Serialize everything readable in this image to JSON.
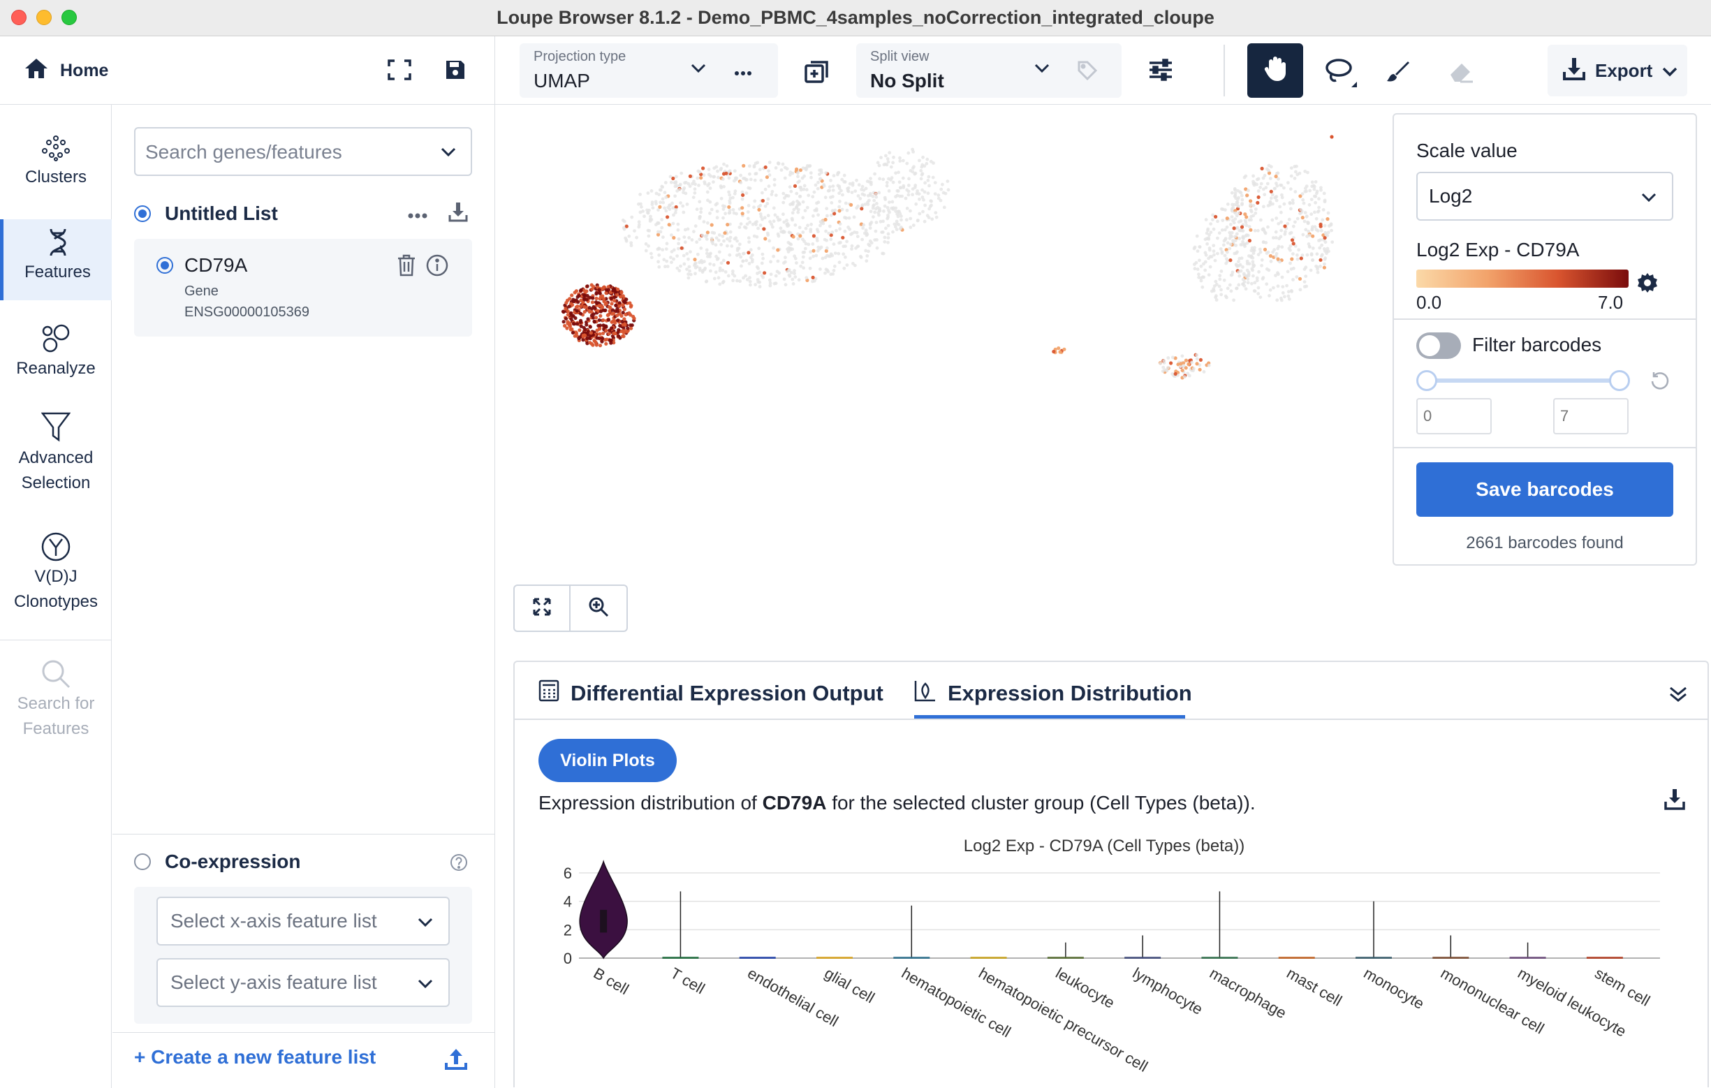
{
  "window": {
    "title": "Loupe Browser 8.1.2 - Demo_PBMC_4samples_noCorrection_integrated_cloupe"
  },
  "toolbar": {
    "home_label": "Home",
    "projection_label": "Projection type",
    "projection_value": "UMAP",
    "split_label": "Split view",
    "split_value": "No Split",
    "export_label": "Export"
  },
  "rail": {
    "items": [
      {
        "label": "Clusters",
        "icon": "clusters-icon"
      },
      {
        "label": "Features",
        "icon": "dna-icon"
      },
      {
        "label": "Reanalyze",
        "icon": "bubbles-icon"
      },
      {
        "label1": "Advanced",
        "label2": "Selection",
        "icon": "funnel-icon"
      },
      {
        "label1": "V(D)J",
        "label2": "Clonotypes",
        "icon": "antibody-icon"
      },
      {
        "label1": "Search for",
        "label2": "Features",
        "icon": "search-icon"
      }
    ]
  },
  "features": {
    "search_placeholder": "Search genes/features",
    "list_title": "Untitled List",
    "item_name": "CD79A",
    "item_type": "Gene",
    "item_id": "ENSG00000105369",
    "coexp_title": "Co-expression",
    "x_placeholder": "Select x-axis feature list",
    "y_placeholder": "Select y-axis feature list",
    "create_link": "+ Create a new feature list"
  },
  "scale": {
    "label": "Scale value",
    "value": "Log2",
    "legend_title": "Log2 Exp - CD79A",
    "min": "0.0",
    "max": "7.0",
    "colors": [
      "#fbd9a8",
      "#f2a36b",
      "#d9552f",
      "#7a0c0c"
    ],
    "filter_label": "Filter barcodes",
    "range_min": "0",
    "range_max": "7",
    "save_label": "Save barcodes",
    "found": "2661 barcodes found"
  },
  "bottom": {
    "tab1": "Differential Expression Output",
    "tab2": "Expression Distribution",
    "violin_btn": "Violin Plots",
    "desc_pre": "Expression distribution of ",
    "desc_gene": "CD79A",
    "desc_post": " for the selected cluster group (Cell Types (beta))."
  },
  "chart_data": {
    "type": "violin",
    "title": "Log2 Exp - CD79A (Cell Types (beta))",
    "categories": [
      "B cell",
      "T cell",
      "endothelial cell",
      "glial cell",
      "hematopoietic cell",
      "hematopoietic precursor cell",
      "leukocyte",
      "lymphocyte",
      "macrophage",
      "mast cell",
      "monocyte",
      "mononuclear cell",
      "myeloid leukocyte",
      "stem cell"
    ],
    "max_values": [
      6.8,
      4.7,
      0,
      0,
      3.7,
      0,
      1.1,
      1.6,
      4.7,
      0,
      4.0,
      1.6,
      1.1,
      0
    ],
    "ylim": [
      0,
      6.5
    ],
    "yticks": [
      0,
      2,
      4,
      6
    ],
    "colors": [
      "#3b1040",
      "#1b6a3a",
      "#1f3fa8",
      "#d9a21b",
      "#2a6e8c",
      "#c9a21a",
      "#556b2f",
      "#3f4a7a",
      "#2f6e4a",
      "#c2601e",
      "#355a6a",
      "#7a4a2f",
      "#6b4a7a",
      "#b23b1e"
    ]
  }
}
